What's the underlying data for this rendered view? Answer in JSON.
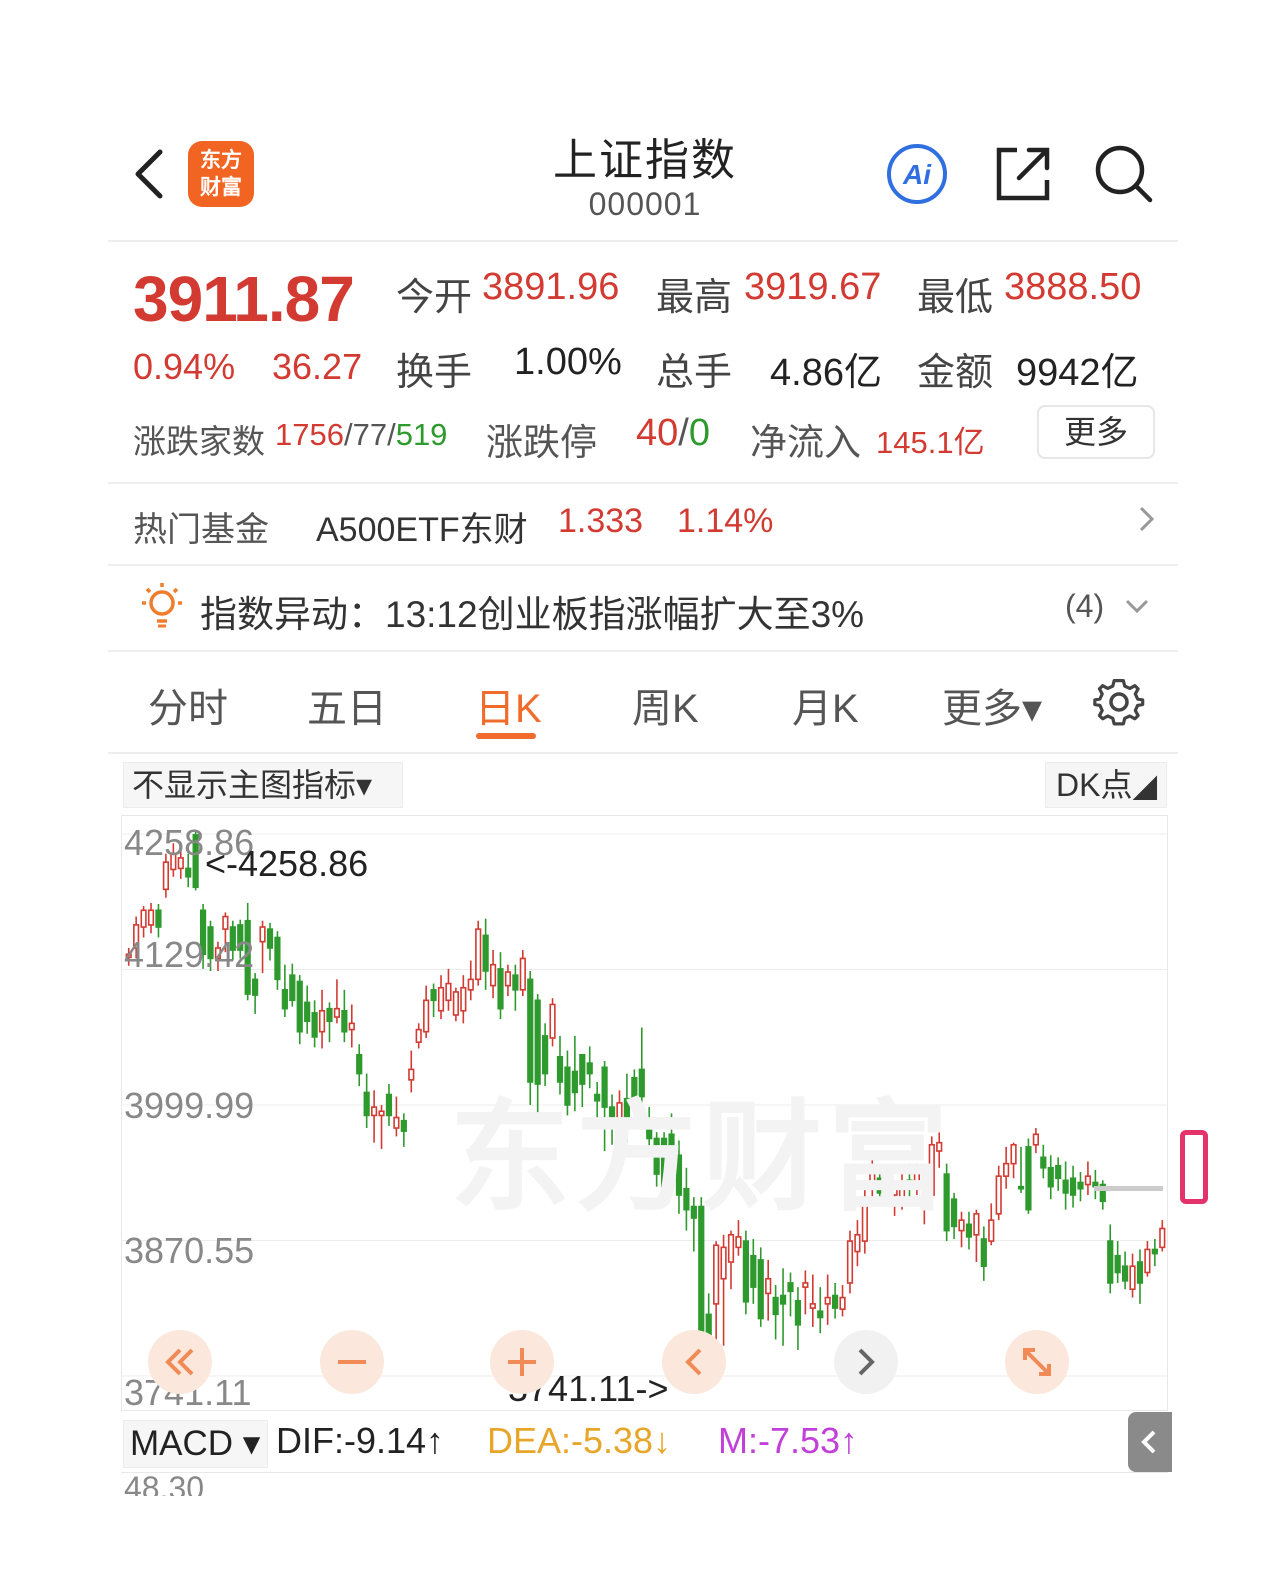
{
  "header": {
    "logo_text": [
      "东方",
      "财富"
    ],
    "title": "上证指数",
    "code": "000001",
    "icons": [
      "back-icon",
      "ai-icon",
      "share-icon",
      "search-icon"
    ]
  },
  "quote": {
    "price": "3911.87",
    "change_pct": "0.94%",
    "change_val": "36.27",
    "open_label": "今开",
    "open": "3891.96",
    "high_label": "最高",
    "high": "3919.67",
    "low_label": "最低",
    "low": "3888.50",
    "turnover_label": "换手",
    "turnover": "1.00%",
    "volume_label": "总手",
    "volume": "4.86亿",
    "amount_label": "金额",
    "amount": "9942亿",
    "breadth_label": "涨跌家数",
    "breadth_up": "1756",
    "breadth_flat": "77",
    "breadth_down": "519",
    "limit_label": "涨跌停",
    "limit_up": "40",
    "limit_down": "0",
    "inflow_label": "净流入",
    "inflow": "145.1亿",
    "more_label": "更多",
    "colors": {
      "up": "#d23a32",
      "down": "#2e9a2e"
    }
  },
  "fund": {
    "label": "热门基金",
    "name": "A500ETF东财",
    "price": "1.333",
    "pct": "1.14%"
  },
  "alert": {
    "label": "指数异动：13:12创业板指涨幅扩大至3%",
    "count": "(4)"
  },
  "tabs": [
    {
      "label": "分时"
    },
    {
      "label": "五日"
    },
    {
      "label": "日K"
    },
    {
      "label": "周K"
    },
    {
      "label": "月K"
    },
    {
      "label": "更多▾"
    }
  ],
  "active_tab": "日K",
  "chart": {
    "indicator_select": "不显示主图指标▾",
    "dk_select": "DK点◢",
    "y_ticks": [
      "4258.86",
      "4129.42",
      "3999.99",
      "3870.55",
      "3741.11"
    ],
    "max_marker": "<-4258.86",
    "min_marker": "3741.11->",
    "watermark": "东方财富",
    "accent": "#ef6c2d"
  },
  "chart_data": {
    "type": "candlestick",
    "ylim": [
      3741.11,
      4258.86
    ],
    "up_color": "#d23a32",
    "down_color": "#2e9a2e",
    "candles": [
      {
        "o": 4141,
        "c": 4144,
        "h": 4150,
        "l": 4133
      },
      {
        "o": 4150,
        "c": 4172,
        "h": 4180,
        "l": 4140
      },
      {
        "o": 4170,
        "c": 4186,
        "h": 4190,
        "l": 4160
      },
      {
        "o": 4172,
        "c": 4186,
        "h": 4193,
        "l": 4164
      },
      {
        "o": 4186,
        "c": 4170,
        "h": 4192,
        "l": 4160
      },
      {
        "o": 4206,
        "c": 4232,
        "h": 4240,
        "l": 4198
      },
      {
        "o": 4225,
        "c": 4240,
        "h": 4250,
        "l": 4218
      },
      {
        "o": 4226,
        "c": 4236,
        "h": 4244,
        "l": 4216
      },
      {
        "o": 4226,
        "c": 4218,
        "h": 4240,
        "l": 4208
      },
      {
        "o": 4258,
        "c": 4208,
        "h": 4262,
        "l": 4205
      },
      {
        "o": 4186,
        "c": 4144,
        "h": 4192,
        "l": 4130
      },
      {
        "o": 4170,
        "c": 4140,
        "h": 4176,
        "l": 4128
      },
      {
        "o": 4140,
        "c": 4150,
        "h": 4156,
        "l": 4128
      },
      {
        "o": 4168,
        "c": 4180,
        "h": 4184,
        "l": 4146
      },
      {
        "o": 4170,
        "c": 4148,
        "h": 4176,
        "l": 4138
      },
      {
        "o": 4172,
        "c": 4148,
        "h": 4177,
        "l": 4140
      },
      {
        "o": 4176,
        "c": 4106,
        "h": 4193,
        "l": 4100
      },
      {
        "o": 4120,
        "c": 4105,
        "h": 4126,
        "l": 4087
      },
      {
        "o": 4156,
        "c": 4170,
        "h": 4176,
        "l": 4126
      },
      {
        "o": 4168,
        "c": 4150,
        "h": 4174,
        "l": 4138
      },
      {
        "o": 4160,
        "c": 4120,
        "h": 4166,
        "l": 4110
      },
      {
        "o": 4110,
        "c": 4092,
        "h": 4134,
        "l": 4084
      },
      {
        "o": 4124,
        "c": 4100,
        "h": 4135,
        "l": 4094
      },
      {
        "o": 4118,
        "c": 4070,
        "h": 4124,
        "l": 4058
      },
      {
        "o": 4098,
        "c": 4080,
        "h": 4114,
        "l": 4068
      },
      {
        "o": 4088,
        "c": 4065,
        "h": 4100,
        "l": 4055
      },
      {
        "o": 4070,
        "c": 4090,
        "h": 4110,
        "l": 4054
      },
      {
        "o": 4092,
        "c": 4080,
        "h": 4098,
        "l": 4060
      },
      {
        "o": 4084,
        "c": 4092,
        "h": 4120,
        "l": 4078
      },
      {
        "o": 4090,
        "c": 4070,
        "h": 4110,
        "l": 4060
      },
      {
        "o": 4072,
        "c": 4078,
        "h": 4096,
        "l": 4055
      },
      {
        "o": 4048,
        "c": 4030,
        "h": 4058,
        "l": 4018
      },
      {
        "o": 4012,
        "c": 3990,
        "h": 4030,
        "l": 3978
      },
      {
        "o": 3990,
        "c": 3998,
        "h": 4014,
        "l": 3964
      },
      {
        "o": 3990,
        "c": 3994,
        "h": 4000,
        "l": 3958
      },
      {
        "o": 4010,
        "c": 3990,
        "h": 4020,
        "l": 3980
      },
      {
        "o": 3978,
        "c": 3988,
        "h": 4008,
        "l": 3970
      },
      {
        "o": 3985,
        "c": 3975,
        "h": 3992,
        "l": 3960
      },
      {
        "o": 4024,
        "c": 4034,
        "h": 4052,
        "l": 4012
      },
      {
        "o": 4060,
        "c": 4072,
        "h": 4078,
        "l": 4054
      },
      {
        "o": 4070,
        "c": 4100,
        "h": 4114,
        "l": 4064
      },
      {
        "o": 4110,
        "c": 4100,
        "h": 4116,
        "l": 4084
      },
      {
        "o": 4090,
        "c": 4112,
        "h": 4124,
        "l": 4082
      },
      {
        "o": 4100,
        "c": 4116,
        "h": 4130,
        "l": 4090
      },
      {
        "o": 4086,
        "c": 4108,
        "h": 4112,
        "l": 4080
      },
      {
        "o": 4090,
        "c": 4112,
        "h": 4124,
        "l": 4078
      },
      {
        "o": 4110,
        "c": 4120,
        "h": 4138,
        "l": 4100
      },
      {
        "o": 4120,
        "c": 4168,
        "h": 4176,
        "l": 4114
      },
      {
        "o": 4162,
        "c": 4128,
        "h": 4178,
        "l": 4110
      },
      {
        "o": 4114,
        "c": 4134,
        "h": 4148,
        "l": 4102
      },
      {
        "o": 4130,
        "c": 4092,
        "h": 4146,
        "l": 4082
      },
      {
        "o": 4114,
        "c": 4127,
        "h": 4134,
        "l": 4104
      },
      {
        "o": 4124,
        "c": 4110,
        "h": 4134,
        "l": 4090
      },
      {
        "o": 4110,
        "c": 4140,
        "h": 4148,
        "l": 4104
      },
      {
        "o": 4120,
        "c": 4022,
        "h": 4128,
        "l": 4000
      },
      {
        "o": 4100,
        "c": 4020,
        "h": 4106,
        "l": 3992
      },
      {
        "o": 4066,
        "c": 4030,
        "h": 4078,
        "l": 4018
      },
      {
        "o": 4064,
        "c": 4096,
        "h": 4102,
        "l": 4056
      },
      {
        "o": 4046,
        "c": 4022,
        "h": 4066,
        "l": 4010
      },
      {
        "o": 4036,
        "c": 4000,
        "h": 4052,
        "l": 3990
      },
      {
        "o": 4032,
        "c": 4012,
        "h": 4066,
        "l": 3994
      },
      {
        "o": 4048,
        "c": 4020,
        "h": 4048,
        "l": 3998
      },
      {
        "o": 4040,
        "c": 4030,
        "h": 4056,
        "l": 4016
      },
      {
        "o": 4010,
        "c": 4004,
        "h": 4022,
        "l": 3986
      },
      {
        "o": 4036,
        "c": 3998,
        "h": 4042,
        "l": 3956
      },
      {
        "o": 3998,
        "c": 3978,
        "h": 4010,
        "l": 3962
      },
      {
        "o": 3986,
        "c": 4002,
        "h": 4014,
        "l": 3972
      },
      {
        "o": 4006,
        "c": 3988,
        "h": 4030,
        "l": 3964
      },
      {
        "o": 4026,
        "c": 4006,
        "h": 4034,
        "l": 3990
      },
      {
        "o": 4034,
        "c": 4008,
        "h": 4074,
        "l": 3996
      },
      {
        "o": 3986,
        "c": 3968,
        "h": 3998,
        "l": 3950
      },
      {
        "o": 3968,
        "c": 3934,
        "h": 3974,
        "l": 3922
      },
      {
        "o": 3968,
        "c": 3920,
        "h": 3974,
        "l": 3912
      },
      {
        "o": 3972,
        "c": 3958,
        "h": 3992,
        "l": 3950
      },
      {
        "o": 3952,
        "c": 3914,
        "h": 3966,
        "l": 3896
      },
      {
        "o": 3920,
        "c": 3900,
        "h": 3940,
        "l": 3880
      },
      {
        "o": 3903,
        "c": 3892,
        "h": 3912,
        "l": 3860
      },
      {
        "o": 3903,
        "c": 3784,
        "h": 3912,
        "l": 3741
      },
      {
        "o": 3800,
        "c": 3778,
        "h": 3820,
        "l": 3741
      },
      {
        "o": 3810,
        "c": 3866,
        "h": 3870,
        "l": 3741
      },
      {
        "o": 3834,
        "c": 3864,
        "h": 3876,
        "l": 3770
      },
      {
        "o": 3850,
        "c": 3876,
        "h": 3880,
        "l": 3824
      },
      {
        "o": 3864,
        "c": 3874,
        "h": 3890,
        "l": 3856
      },
      {
        "o": 3870,
        "c": 3812,
        "h": 3880,
        "l": 3800
      },
      {
        "o": 3856,
        "c": 3826,
        "h": 3872,
        "l": 3810
      },
      {
        "o": 3852,
        "c": 3796,
        "h": 3864,
        "l": 3788
      },
      {
        "o": 3820,
        "c": 3834,
        "h": 3852,
        "l": 3794
      },
      {
        "o": 3816,
        "c": 3800,
        "h": 3828,
        "l": 3776
      },
      {
        "o": 3818,
        "c": 3810,
        "h": 3844,
        "l": 3770
      },
      {
        "o": 3830,
        "c": 3822,
        "h": 3840,
        "l": 3798
      },
      {
        "o": 3813,
        "c": 3790,
        "h": 3826,
        "l": 3766
      },
      {
        "o": 3826,
        "c": 3830,
        "h": 3842,
        "l": 3800
      },
      {
        "o": 3806,
        "c": 3810,
        "h": 3838,
        "l": 3788
      },
      {
        "o": 3803,
        "c": 3797,
        "h": 3826,
        "l": 3782
      },
      {
        "o": 3810,
        "c": 3816,
        "h": 3838,
        "l": 3790
      },
      {
        "o": 3818,
        "c": 3806,
        "h": 3830,
        "l": 3796
      },
      {
        "o": 3805,
        "c": 3816,
        "h": 3828,
        "l": 3798
      },
      {
        "o": 3830,
        "c": 3870,
        "h": 3880,
        "l": 3820
      },
      {
        "o": 3860,
        "c": 3876,
        "h": 3890,
        "l": 3846
      },
      {
        "o": 3870,
        "c": 3912,
        "h": 3928,
        "l": 3858
      },
      {
        "o": 3924,
        "c": 3942,
        "h": 3950,
        "l": 3912
      },
      {
        "o": 3930,
        "c": 3916,
        "h": 3942,
        "l": 3910
      },
      {
        "o": 3920,
        "c": 3928,
        "h": 3940,
        "l": 3906
      },
      {
        "o": 3914,
        "c": 3920,
        "h": 3926,
        "l": 3894
      },
      {
        "o": 3910,
        "c": 3925,
        "h": 3934,
        "l": 3900
      },
      {
        "o": 3928,
        "c": 3920,
        "h": 3944,
        "l": 3910
      },
      {
        "o": 3924,
        "c": 3940,
        "h": 3944,
        "l": 3914
      },
      {
        "o": 3908,
        "c": 3918,
        "h": 3926,
        "l": 3886
      },
      {
        "o": 3914,
        "c": 3962,
        "h": 3970,
        "l": 3908
      },
      {
        "o": 3956,
        "c": 3964,
        "h": 3974,
        "l": 3940
      },
      {
        "o": 3934,
        "c": 3880,
        "h": 3944,
        "l": 3870
      },
      {
        "o": 3910,
        "c": 3884,
        "h": 3916,
        "l": 3872
      },
      {
        "o": 3880,
        "c": 3890,
        "h": 3898,
        "l": 3864
      },
      {
        "o": 3886,
        "c": 3874,
        "h": 3898,
        "l": 3862
      },
      {
        "o": 3876,
        "c": 3896,
        "h": 3900,
        "l": 3850
      },
      {
        "o": 3872,
        "c": 3846,
        "h": 3884,
        "l": 3832
      },
      {
        "o": 3870,
        "c": 3890,
        "h": 3906,
        "l": 3866
      },
      {
        "o": 3896,
        "c": 3932,
        "h": 3942,
        "l": 3890
      },
      {
        "o": 3932,
        "c": 3944,
        "h": 3960,
        "l": 3920
      },
      {
        "o": 3944,
        "c": 3962,
        "h": 3964,
        "l": 3930
      },
      {
        "o": 3922,
        "c": 3920,
        "h": 3960,
        "l": 3916
      },
      {
        "o": 3960,
        "c": 3900,
        "h": 3968,
        "l": 3896
      },
      {
        "o": 3962,
        "c": 3972,
        "h": 3978,
        "l": 3954
      },
      {
        "o": 3950,
        "c": 3940,
        "h": 3962,
        "l": 3930
      },
      {
        "o": 3940,
        "c": 3922,
        "h": 3952,
        "l": 3910
      },
      {
        "o": 3942,
        "c": 3930,
        "h": 3950,
        "l": 3918
      },
      {
        "o": 3928,
        "c": 3916,
        "h": 3946,
        "l": 3900
      },
      {
        "o": 3930,
        "c": 3914,
        "h": 3942,
        "l": 3902
      },
      {
        "o": 3926,
        "c": 3920,
        "h": 3936,
        "l": 3908
      },
      {
        "o": 3924,
        "c": 3932,
        "h": 3946,
        "l": 3914
      },
      {
        "o": 3926,
        "c": 3922,
        "h": 3938,
        "l": 3910
      },
      {
        "o": 3924,
        "c": 3908,
        "h": 3928,
        "l": 3900
      },
      {
        "o": 3870,
        "c": 3830,
        "h": 3886,
        "l": 3820
      },
      {
        "o": 3856,
        "c": 3840,
        "h": 3870,
        "l": 3830
      },
      {
        "o": 3846,
        "c": 3832,
        "h": 3860,
        "l": 3824
      },
      {
        "o": 3824,
        "c": 3846,
        "h": 3858,
        "l": 3816
      },
      {
        "o": 3850,
        "c": 3830,
        "h": 3862,
        "l": 3810
      },
      {
        "o": 3840,
        "c": 3862,
        "h": 3870,
        "l": 3836
      },
      {
        "o": 3862,
        "c": 3858,
        "h": 3872,
        "l": 3846
      },
      {
        "o": 3864,
        "c": 3882,
        "h": 3890,
        "l": 3860
      }
    ]
  },
  "macd": {
    "select": "MACD ▾",
    "dif": "DIF:-9.14↑",
    "dea": "DEA:-5.38↓",
    "m": "M:-7.53↑",
    "partial_tick": "48.30",
    "colors": {
      "dif": "#222222",
      "dea": "#e7a52a",
      "m": "#c040d8"
    }
  }
}
